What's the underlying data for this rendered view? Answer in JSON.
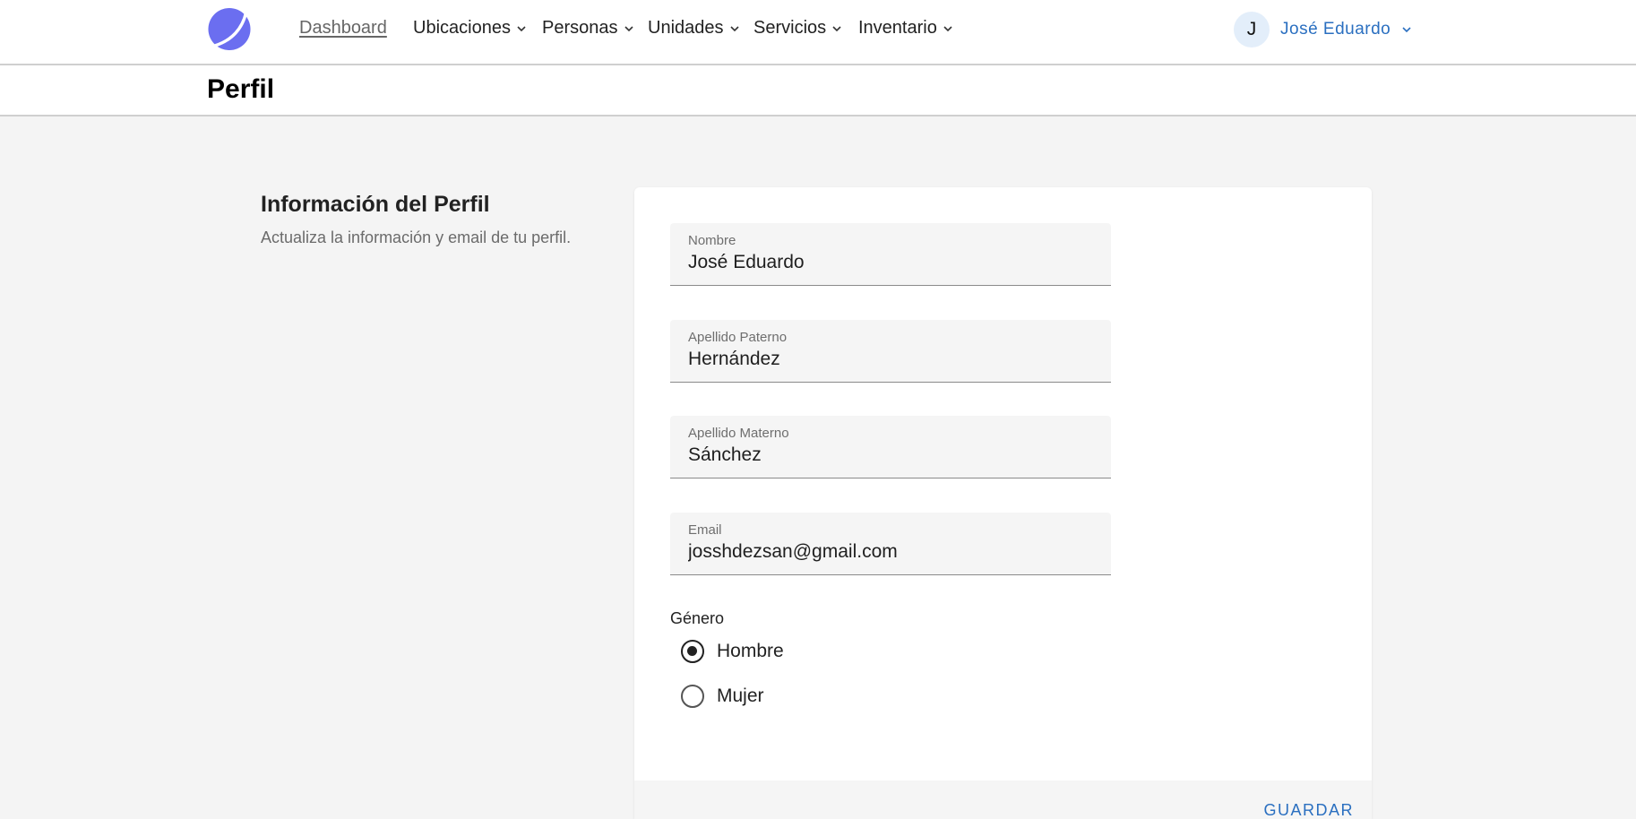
{
  "nav": {
    "dashboard": "Dashboard",
    "items": [
      {
        "label": "Ubicaciones"
      },
      {
        "label": "Personas"
      },
      {
        "label": "Unidades"
      },
      {
        "label": "Servicios"
      },
      {
        "label": "Inventario"
      }
    ],
    "user": {
      "initial": "J",
      "name": "José Eduardo"
    }
  },
  "page": {
    "title": "Perfil"
  },
  "section": {
    "title": "Información del Perfil",
    "description": "Actualiza la información y email de tu perfil."
  },
  "form": {
    "nombre": {
      "label": "Nombre",
      "value": "José Eduardo"
    },
    "apellido_paterno": {
      "label": "Apellido Paterno",
      "value": "Hernández"
    },
    "apellido_materno": {
      "label": "Apellido Materno",
      "value": "Sánchez"
    },
    "email": {
      "label": "Email",
      "value": "josshdezsan@gmail.com"
    },
    "genero": {
      "label": "Género",
      "options": [
        {
          "label": "Hombre",
          "selected": true
        },
        {
          "label": "Mujer",
          "selected": false
        }
      ]
    },
    "save_label": "GUARDAR"
  },
  "colors": {
    "accent": "#2a6fc0",
    "logo": "#6b6ef0",
    "background": "#f4f4f4"
  }
}
